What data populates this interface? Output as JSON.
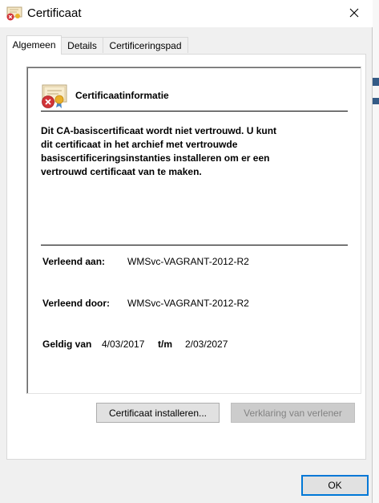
{
  "window": {
    "title": "Certificaat"
  },
  "tabs": [
    {
      "label": "Algemeen",
      "active": true
    },
    {
      "label": "Details",
      "active": false
    },
    {
      "label": "Certificeringspad",
      "active": false
    }
  ],
  "general": {
    "heading": "Certificaatinformatie",
    "warning_lines": [
      "Dit CA-basiscertificaat wordt niet vertrouwd. U kunt",
      "dit certificaat in het archief met vertrouwde",
      "basiscertificeringsinstanties installeren om er een",
      "vertrouwd certificaat van te maken."
    ],
    "issued_to_label": "Verleend aan:",
    "issued_to_value": "WMSvc-VAGRANT-2012-R2",
    "issued_by_label": "Verleend door:",
    "issued_by_value": "WMSvc-VAGRANT-2012-R2",
    "valid_from_label": "Geldig van",
    "valid_from_value": "4/03/2017",
    "valid_to_label": "t/m",
    "valid_to_value": "2/03/2027"
  },
  "buttons": {
    "install": "Certificaat installeren...",
    "issuer_statement": "Verklaring van verlener",
    "ok": "OK"
  },
  "colors": {
    "accent": "#0078d7",
    "error_red": "#d13438"
  },
  "icons": {
    "title": "certificate-error-icon",
    "close": "close-icon",
    "cert": "certificate-error-icon"
  }
}
